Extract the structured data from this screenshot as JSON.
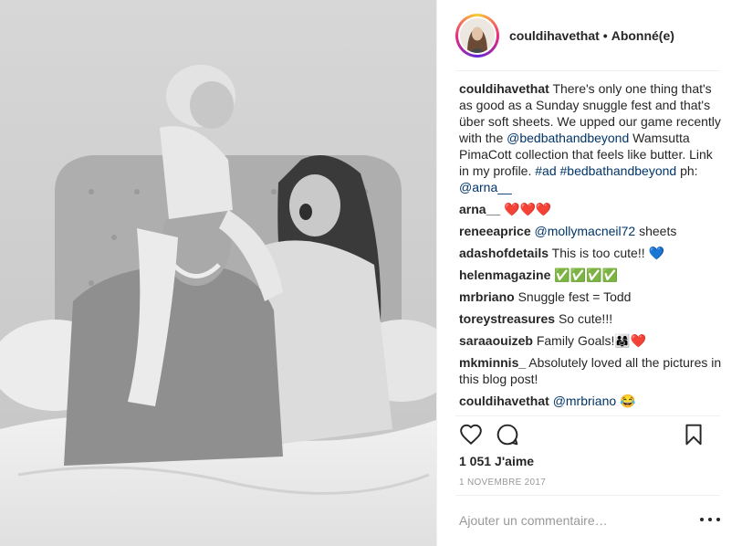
{
  "post": {
    "author": "couldihavethat",
    "separator": "•",
    "follow_status": "Abonné(e)"
  },
  "caption": {
    "user": "couldihavethat",
    "text_1": "There's only one thing that's as good as a Sunday snuggle fest and that's über soft sheets. We upped our game recently with the ",
    "mention": "@bedbathandbeyond",
    "text_2": " Wamsutta PimaCott collection that feels like butter. Link in my profile. ",
    "hashtag_1": "#ad",
    "hashtag_2": "#bedbathandbeyond",
    "text_3": " ph: ",
    "mention_2": "@arna__"
  },
  "comments": [
    {
      "user": "arna__",
      "text": "❤️❤️❤️"
    },
    {
      "user": "reneeaprice",
      "mention": "@mollymacneil72",
      "text": " sheets"
    },
    {
      "user": "adashofdetails",
      "text": "This is too cute!! 💙"
    },
    {
      "user": "helenmagazine",
      "text": "✅✅✅✅"
    },
    {
      "user": "mrbriano",
      "text": "Snuggle fest = Todd"
    },
    {
      "user": "toreystreasures",
      "text": "So cute!!!"
    },
    {
      "user": "saraaouizeb",
      "text": "Family Goals!👨‍👩‍👧❤️"
    },
    {
      "user": "mkminnis_",
      "text": "Absolutely loved all the pictures in this blog post!"
    },
    {
      "user": "couldihavethat",
      "mention": "@mrbriano",
      "text": " 😂"
    }
  ],
  "engagement": {
    "likes_count": "1 051",
    "likes_label": "J'aime",
    "date": "1 NOVEMBRE 2017"
  },
  "comment_box": {
    "placeholder": "Ajouter un commentaire…"
  },
  "icons": {
    "like": "heart-icon",
    "comment": "speech-bubble-icon",
    "save": "bookmark-icon",
    "options": "more-options-icon"
  },
  "colors": {
    "link": "#003569",
    "text": "#262626",
    "muted": "#999999",
    "divider": "#efefef"
  }
}
